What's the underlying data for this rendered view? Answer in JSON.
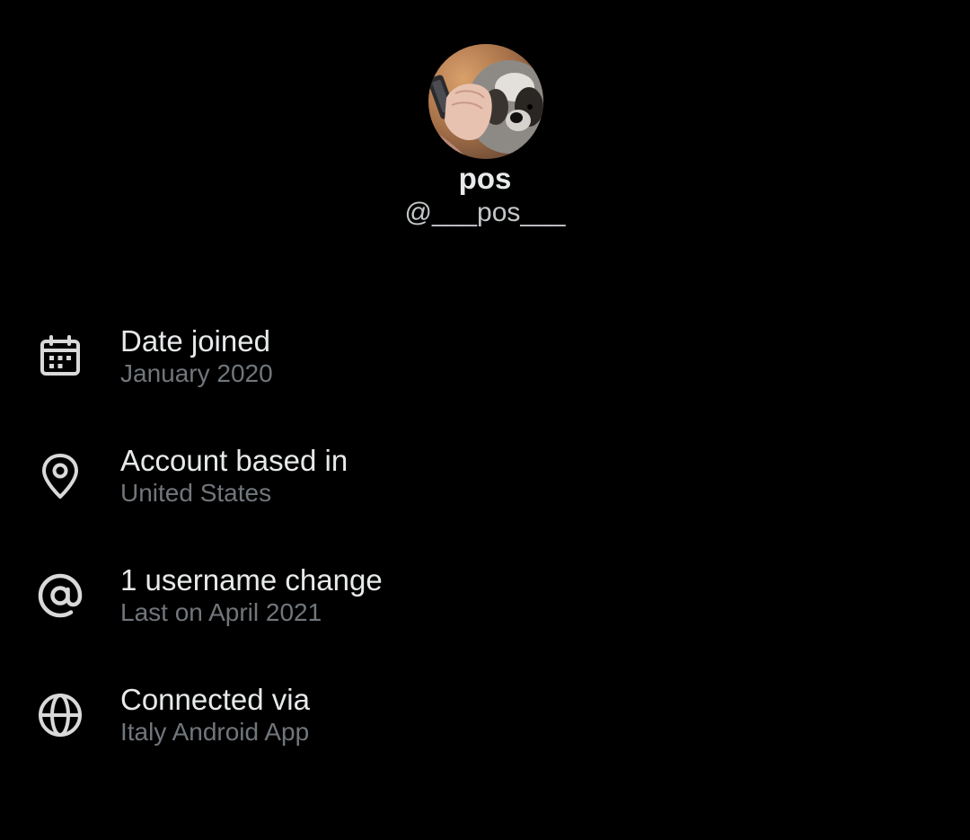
{
  "profile": {
    "display_name": "pos",
    "handle": "@___pos___"
  },
  "info": [
    {
      "icon": "calendar-icon",
      "title": "Date joined",
      "subtitle": "January 2020"
    },
    {
      "icon": "location-pin-icon",
      "title": "Account based in",
      "subtitle": "United States"
    },
    {
      "icon": "at-sign-icon",
      "title": "1 username change",
      "subtitle": "Last on April 2021"
    },
    {
      "icon": "globe-icon",
      "title": "Connected via",
      "subtitle": "Italy Android App"
    }
  ],
  "colors": {
    "background": "#000000",
    "primary_text": "#e7e9ea",
    "secondary_text": "#71767b",
    "icon": "#d9d9d9"
  }
}
